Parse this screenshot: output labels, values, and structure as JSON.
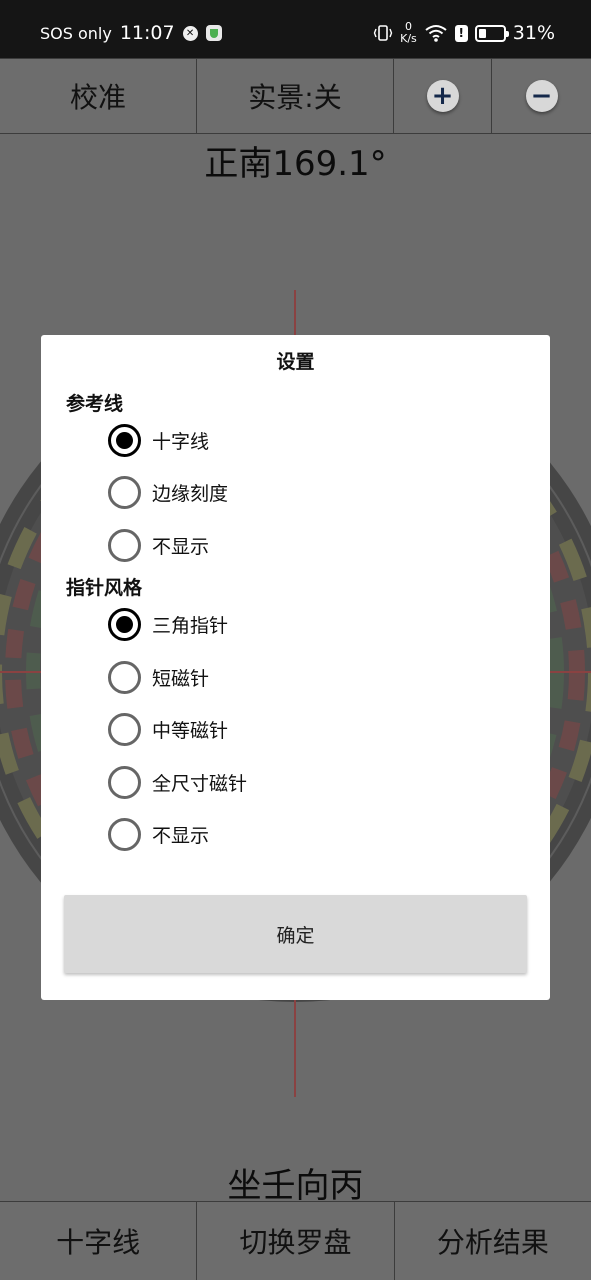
{
  "status_bar": {
    "carrier": "SOS only",
    "time": "11:07",
    "net_speed_value": "0",
    "net_speed_unit": "K/s",
    "battery_percent": "31%",
    "battery_level": 0.31
  },
  "toolbar": {
    "calibrate_label": "校准",
    "live_view_label": "实景:关",
    "zoom_in_label": "+",
    "zoom_out_label": "−"
  },
  "heading": "正南169.1°",
  "sitting": "坐壬向丙",
  "bottom_bar": {
    "crosshair_label": "十字线",
    "switch_label": "切换罗盘",
    "result_label": "分析结果"
  },
  "dialog": {
    "title": "设置",
    "reference_line": {
      "title": "参考线",
      "options": [
        "十字线",
        "边缘刻度",
        "不显示"
      ],
      "selected": 0
    },
    "pointer_style": {
      "title": "指针风格",
      "options": [
        "三角指针",
        "短磁针",
        "中等磁针",
        "全尺寸磁针",
        "不显示"
      ],
      "selected": 0
    },
    "confirm_label": "确定"
  },
  "colors": {
    "status_bar_bg": "#151515",
    "overlay_bg": "#6b6b6b",
    "crosshair": "#b01010",
    "dialog_bg": "#ffffff",
    "button_bg": "#d9d9d9"
  }
}
